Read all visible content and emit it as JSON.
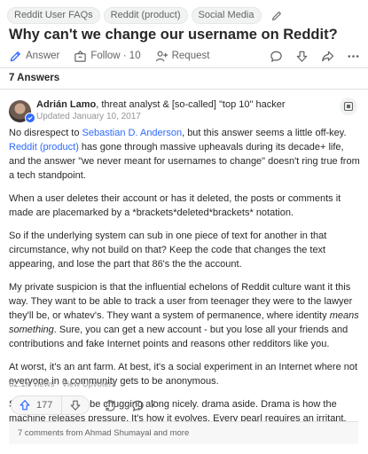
{
  "topics": [
    "Reddit User FAQs",
    "Reddit (product)",
    "Social Media"
  ],
  "question": {
    "title": "Why can't we change our username on Reddit?"
  },
  "actions": {
    "answer": "Answer",
    "follow": "Follow · 10",
    "request": "Request"
  },
  "answers_count": "7 Answers",
  "answer": {
    "author_name": "Adrián Lamo",
    "author_credential": ", threat analyst & [so-called] \"top 10\" hacker",
    "updated": "Updated January 10, 2017",
    "p1": {
      "a": "No disrespect to ",
      "link1": "Sebastian D. Anderson",
      "b": ", but this answer seems a little off-key. ",
      "link2": "Reddit (product)",
      "c": " has gone through massive upheavals during its decade+ life, and the answer \"we never meant for usernames to change\" doesn't ring true from a tech standpoint."
    },
    "p2": "When a user deletes their account or has it deleted, the posts or comments it made are placemarked by a *brackets*deleted*brackets* notation.",
    "p3": "So if the underlying system can sub in one piece of text for another in that circumstance, why not build on that? Keep the code that changes the text appearing, and lose the part that 86's the the account.",
    "p4": {
      "a": "My private suspicion is that the influential echelons of Reddit culture want it this way. They want to be able to track a user from teenager they were to the lawyer they'll be, or whatev's. They want a system of permanence, where identity ",
      "em": "means something",
      "b": ". Sure, you can get a new account - but you lose all your friends and contributions and fake Internet points and reasons other redditors like you."
    },
    "p5": "At worst, it's an ant farm. At best, it's a social experiment in an Internet where not everyone in a community gets to be anonymous.",
    "p6": "So far, it seems to be chugging along nicely. drama aside. Drama is how the machine releases pressure. It's how it evolves. Every pearl requires an irritant.",
    "views": "62.1K views · View Upvoters",
    "upvotes": "177",
    "comments": "7"
  },
  "comments_preview": "7 comments from Ahmad Shumayal and more",
  "colors": {
    "link": "#2e69ff",
    "text": "#282829",
    "muted": "#636466"
  }
}
